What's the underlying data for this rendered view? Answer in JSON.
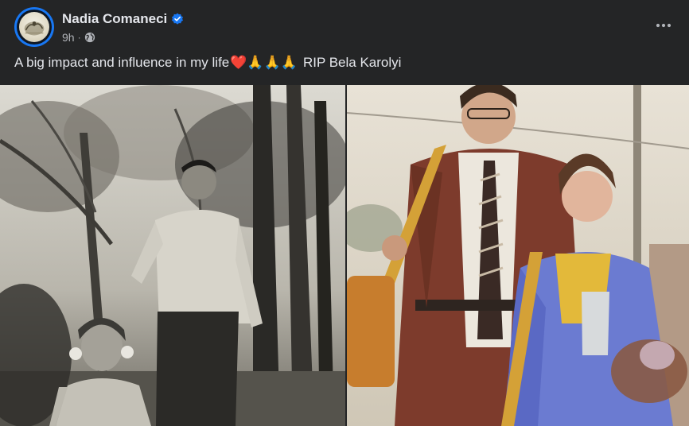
{
  "post": {
    "author": "Nadia Comaneci",
    "time": "9h",
    "separator": "·",
    "caption_text": "A big impact and influence in my life",
    "caption_emojis": "❤️🙏🙏🙏",
    "caption_tail": "RIP Bela Karolyi"
  },
  "icons": {
    "verified": "verified-badge-icon",
    "audience": "globe-icon",
    "more": "more-options-icon"
  },
  "colors": {
    "background": "#242526",
    "text": "#e4e6eb",
    "secondary_text": "#b0b3b8",
    "accent": "#1877f2"
  }
}
